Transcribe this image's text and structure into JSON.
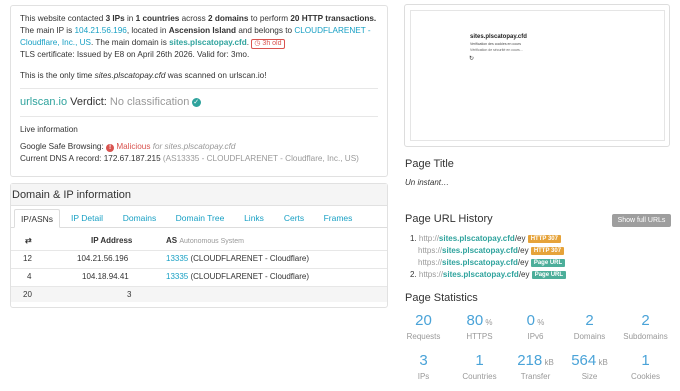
{
  "summary": {
    "l1_a": "This website contacted ",
    "l1_ips": "3 IPs",
    "l1_b": " in ",
    "l1_countries": "1 countries",
    "l1_c": " across ",
    "l1_domains": "2 domains",
    "l1_d": " to perform ",
    "l1_transactions": "20 HTTP transactions.",
    "l2_a": "The main IP is ",
    "l2_ip": "104.21.56.196",
    "l2_b": ", located in ",
    "l2_loc": "Ascension Island",
    "l2_c": " and belongs to ",
    "l2_asn": "CLOUDFLARENET -",
    "l3_asn": "Cloudflare, Inc., US",
    "l3_a": ". The main domain is ",
    "l3_domain": "sites.plscatopay.cfd",
    "l3_b": ".",
    "l3_badge": "3h old",
    "l4": "TLS certificate: Issued by E8 on April 26th 2026. Valid for: 3mo.",
    "l5_a": "This is the only time ",
    "l5_domain": "sites.plscatopay.cfd",
    "l5_b": " was scanned on urlscan.io!",
    "verdict_brand": "urlscan.io",
    "verdict_label": " Verdict: ",
    "verdict_value": "No classification",
    "live_title": "Live information",
    "gsb_label": "Google Safe Browsing: ",
    "gsb_value": "Malicious",
    "gsb_for": " for sites.plscatopay.cfd",
    "dns_label": "Current DNS A record: 172.67.187.215 ",
    "dns_as": "(AS13335 - CLOUDFLARENET - Cloudflare, Inc., US)"
  },
  "domain_ip": {
    "title": "Domain & IP information",
    "tabs": [
      "IP/ASNs",
      "IP Detail",
      "Domains",
      "Domain Tree",
      "Links",
      "Certs",
      "Frames"
    ],
    "headers": {
      "count": "⇄",
      "ip": "IP Address",
      "as": "AS",
      "as_sub": "Autonomous System"
    },
    "rows": [
      {
        "count": "12",
        "ip": "104.21.56.196",
        "as_num": "13335",
        "as_name": " (CLOUDFLARENET - Cloudflare)"
      },
      {
        "count": "4",
        "ip": "104.18.94.41",
        "as_num": "13335",
        "as_name": " (CLOUDFLARENET - Cloudflare)"
      }
    ],
    "total": {
      "count": "20",
      "ips": "3"
    }
  },
  "screenshot": {
    "site_title": "sites.plscatopay.cfd",
    "site_sub": "Verification des cookies en cours",
    "site_line": "Vérification de sécurité en cours...",
    "spinner": "↻"
  },
  "page_title": {
    "heading": "Page Title",
    "value": "Un instant…"
  },
  "url_history": {
    "heading": "Page URL History",
    "button": "Show full URLs",
    "items": [
      {
        "num": "1. ",
        "prefix": "http://",
        "host": "sites.plscatopay.cfd",
        "path": "/ey",
        "tag": "HTTP 307",
        "kind": "r307"
      },
      {
        "num": "",
        "prefix": "https://",
        "host": "sites.plscatopay.cfd",
        "path": "/ey",
        "tag": "HTTP 307",
        "kind": "r307"
      },
      {
        "num": "",
        "prefix": "https://",
        "host": "sites.plscatopay.cfd",
        "path": "/ey",
        "tag": "Page URL",
        "kind": "pu"
      },
      {
        "num": "2. ",
        "prefix": "https://",
        "host": "sites.plscatopay.cfd",
        "path": "/ey",
        "tag": "Page URL",
        "kind": "pu"
      }
    ]
  },
  "stats": {
    "heading": "Page Statistics",
    "row1": [
      {
        "val": "20",
        "unit": "",
        "label": "Requests"
      },
      {
        "val": "80",
        "unit": " %",
        "label": "HTTPS"
      },
      {
        "val": "0",
        "unit": " %",
        "label": "IPv6"
      },
      {
        "val": "2",
        "unit": "",
        "label": "Domains"
      },
      {
        "val": "2",
        "unit": "",
        "label": "Subdomains"
      }
    ],
    "row2": [
      {
        "val": "3",
        "unit": "",
        "label": "IPs"
      },
      {
        "val": "1",
        "unit": "",
        "label": "Countries"
      },
      {
        "val": "218",
        "unit": " kB",
        "label": "Transfer"
      },
      {
        "val": "564",
        "unit": " kB",
        "label": "Size"
      },
      {
        "val": "1",
        "unit": "",
        "label": "Cookies"
      }
    ]
  },
  "colors": {
    "link": "#18a0c4",
    "accent": "#2fa39d",
    "stat": "#4aa3d8",
    "malicious": "#d9534f",
    "tag307": "#e6a33a",
    "tagPage": "#4cae9a"
  }
}
